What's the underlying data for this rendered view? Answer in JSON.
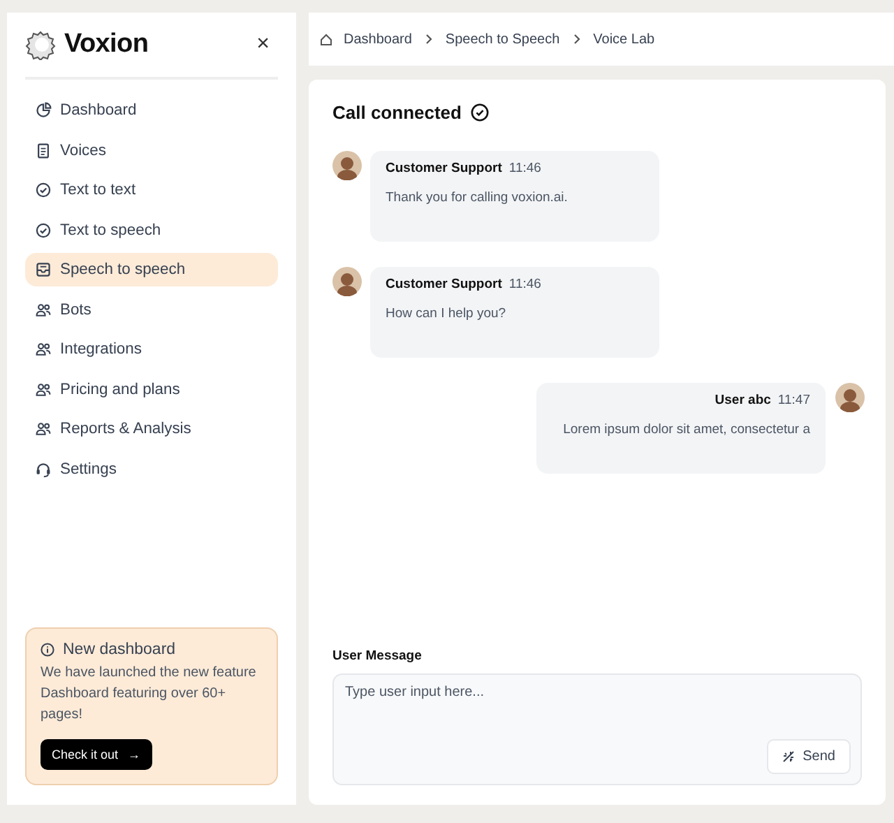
{
  "sidebar": {
    "brand": "Voxion",
    "close": "×",
    "items": [
      {
        "label": "Dashboard",
        "selected": false
      },
      {
        "label": "Voices",
        "selected": false
      },
      {
        "label": "Text to text",
        "selected": false
      },
      {
        "label": "Text to speech",
        "selected": false
      },
      {
        "label": "Speech to speech",
        "selected": true
      },
      {
        "label": "Bots",
        "selected": false
      },
      {
        "label": "Integrations",
        "selected": false
      },
      {
        "label": "Pricing and plans",
        "selected": false
      },
      {
        "label": "Reports & Analysis",
        "selected": false
      },
      {
        "label": "Settings",
        "selected": false
      }
    ],
    "promo": {
      "title": "New dashboard",
      "text": "We have launched the new feature Dashboard featuring over 60+ pages!",
      "button": "Check it out",
      "button_icon": "→"
    }
  },
  "breadcrumb": [
    "Dashboard",
    "Speech to Speech",
    "Voice Lab"
  ],
  "chat": {
    "title": "Call connected",
    "messages": [
      {
        "kind": "agent",
        "sender": "Customer Support",
        "time": "11:46",
        "text": "Thank you for calling voxion.ai."
      },
      {
        "kind": "agent",
        "sender": "Customer Support",
        "time": "11:46",
        "text": "How can I help you?"
      },
      {
        "kind": "user",
        "sender": "User abc",
        "time": "11:47",
        "text": "Lorem ipsum dolor sit amet, consectetur a"
      }
    ],
    "input_label": "User Message",
    "placeholder": "Type user input here...",
    "send": "Send"
  }
}
